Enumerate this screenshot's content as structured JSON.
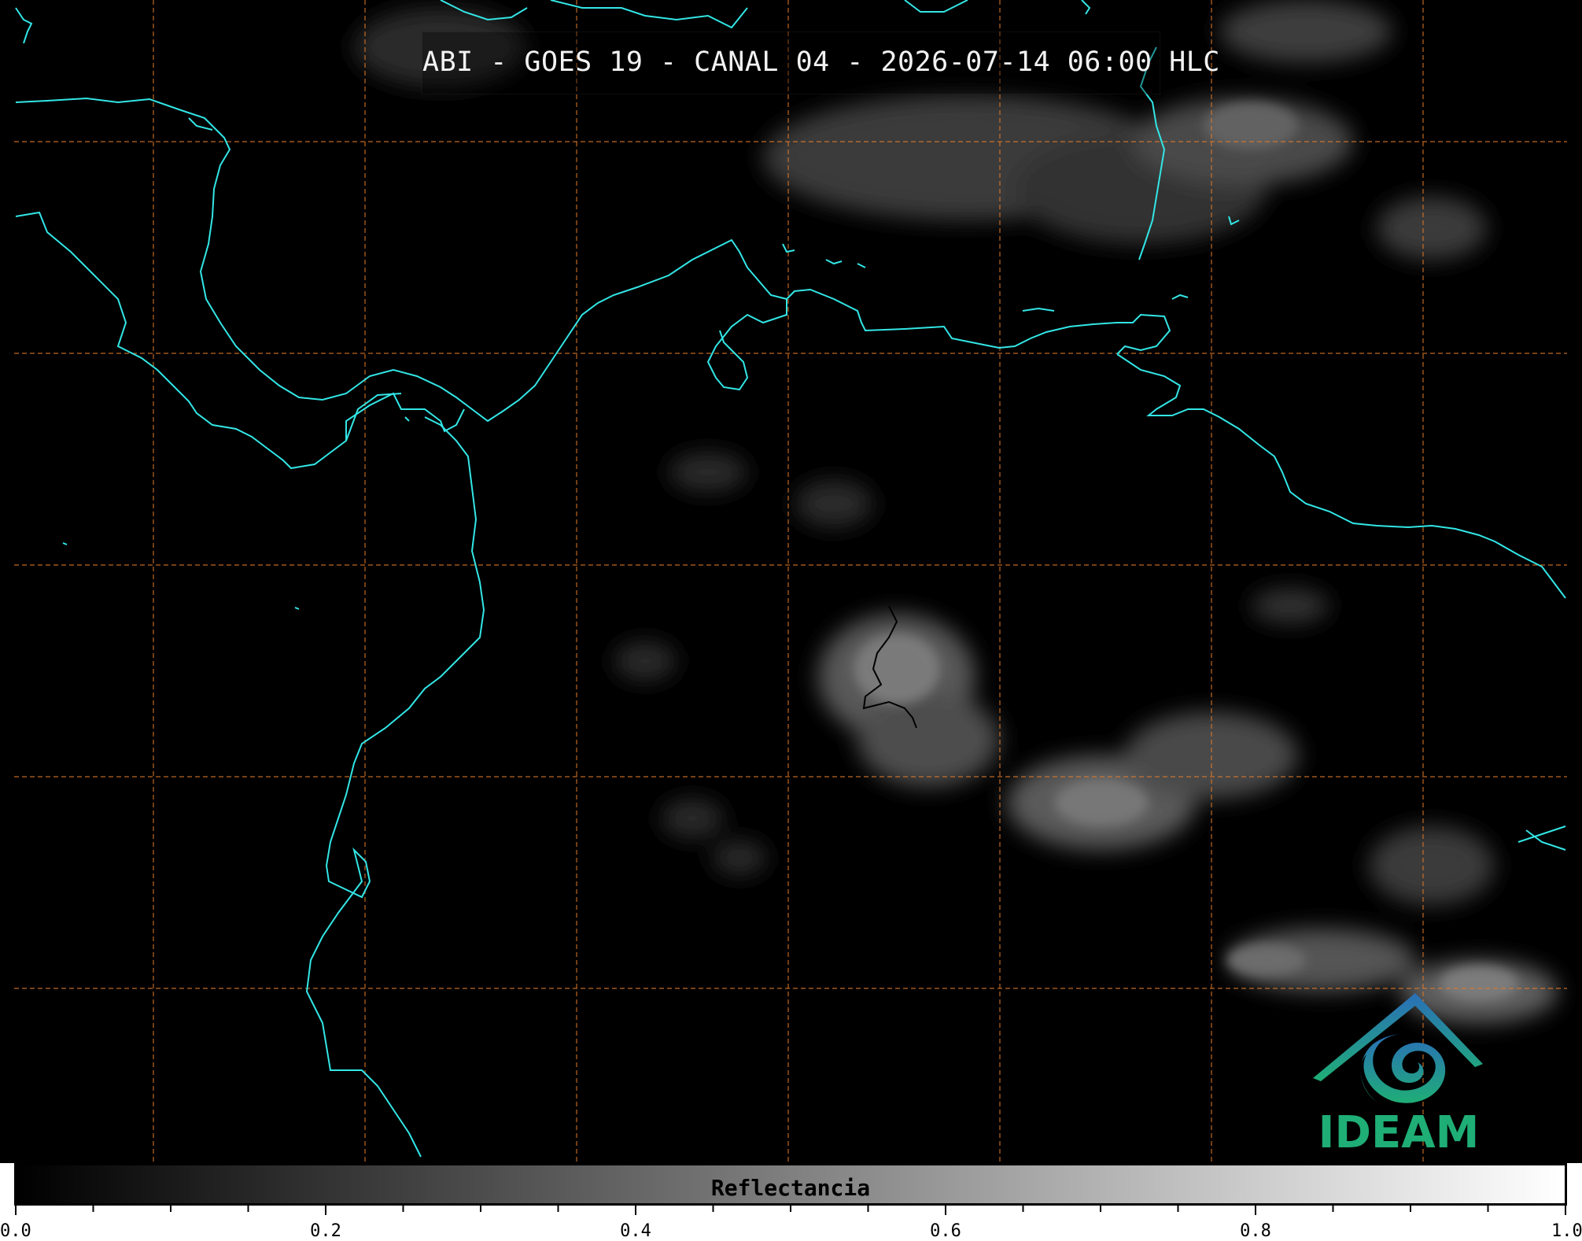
{
  "title": "ABI - GOES 19 - CANAL 04 - 2026-07-14 06:00 HLC",
  "colorbar": {
    "label": "Reflectancia",
    "min": 0.0,
    "max": 1.0,
    "major_ticks": [
      "0.0",
      "0.2",
      "0.4",
      "0.6",
      "0.8",
      "1.0"
    ],
    "colormap": [
      "#000000",
      "#ffffff"
    ]
  },
  "logo": {
    "text": "IDEAM",
    "colors": [
      "#2a6fb8",
      "#1fae76"
    ],
    "icon": "ideam-logo-icon"
  },
  "map": {
    "coastline_color": "#33e6e6",
    "gridline_color": "#e07a2a",
    "background": "#000000",
    "gridlines": "dashed"
  }
}
